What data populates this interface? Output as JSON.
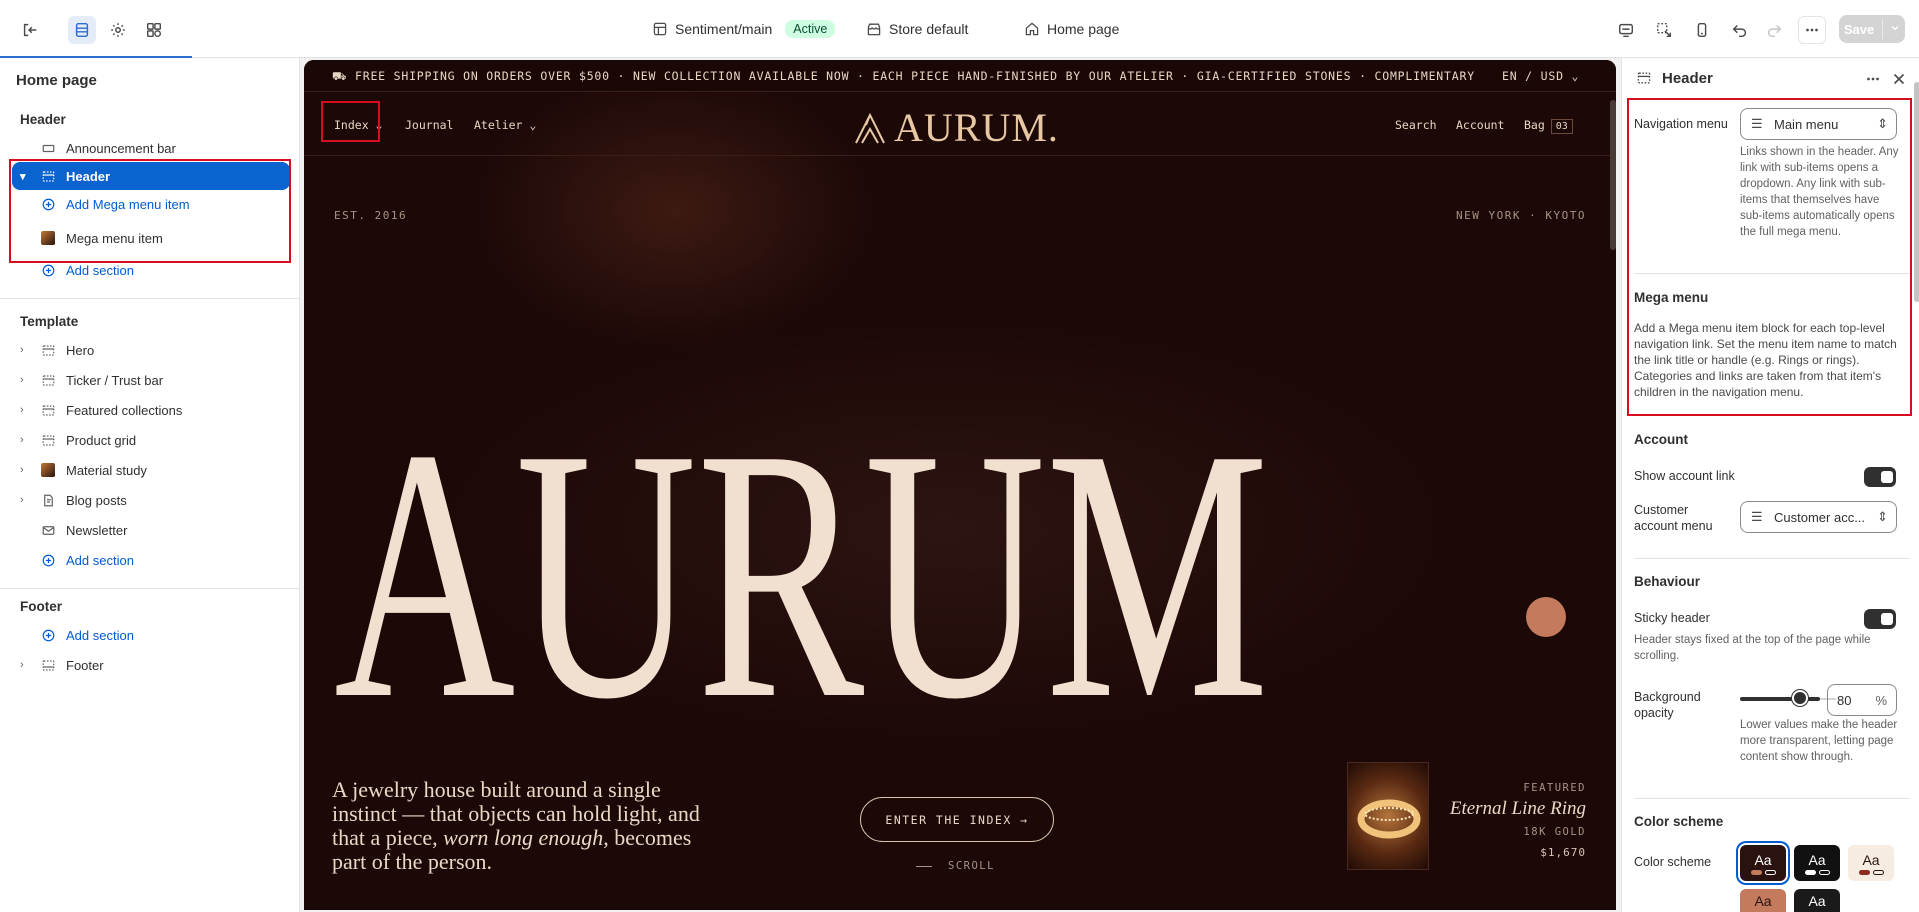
{
  "topbar": {
    "theme_name": "Sentiment/main",
    "theme_status": "Active",
    "store": "Store default",
    "page": "Home page",
    "save_label": "Save"
  },
  "left": {
    "title": "Home page",
    "header_group": "Header",
    "items_header": {
      "announcement": "Announcement bar",
      "header": "Header",
      "add_mega": "Add Mega menu item",
      "mega_item": "Mega menu item",
      "add_section": "Add section"
    },
    "template_group": "Template",
    "template_items": [
      "Hero",
      "Ticker / Trust bar",
      "Featured collections",
      "Product grid",
      "Material study",
      "Blog posts",
      "Newsletter"
    ],
    "template_add": "Add section",
    "footer_group": "Footer",
    "footer_add": "Add section",
    "footer_item": "Footer"
  },
  "preview": {
    "ticker": "FREE SHIPPING ON ORDERS OVER $500 · NEW COLLECTION AVAILABLE NOW · EACH PIECE HAND-FINISHED BY OUR ATELIER · GIA-CERTIFIED STONES · COMPLIMENTARY",
    "currency": "EN / USD",
    "nav_index": "Index",
    "nav_journal": "Journal",
    "nav_atelier": "Atelier",
    "logo": "AURUM.",
    "nav_search": "Search",
    "nav_account": "Account",
    "nav_bag": "Bag",
    "bag_count": "03",
    "est": "EST. 2016",
    "cities": "NEW YORK · KYOTO",
    "hero_word": "AURUM",
    "tagline_1": "A jewelry house built around a single instinct — that objects can hold light, and that a piece, ",
    "tagline_em": "worn long enough,",
    "tagline_2": " becomes part of the person.",
    "cta": "ENTER THE INDEX →",
    "scroll": "SCROLL",
    "featured_label": "FEATURED",
    "featured_name": "Eternal Line Ring",
    "featured_material": "18K GOLD",
    "featured_price": "$1,670"
  },
  "right": {
    "title": "Header",
    "nav_menu_label": "Navigation menu",
    "nav_menu_value": "Main menu",
    "nav_menu_help": "Links shown in the header. Any link with sub-items opens a dropdown. Any link with sub-items that themselves have sub-items automatically opens the full mega menu.",
    "mega_title": "Mega menu",
    "mega_help": "Add a Mega menu item block for each top-level navigation link. Set the menu item name to match the link title or handle (e.g. Rings or rings). Categories and links are taken from that item's children in the navigation menu.",
    "account_title": "Account",
    "show_account": "Show account link",
    "customer_menu_label": "Customer account menu",
    "customer_menu_value": "Customer acc...",
    "behaviour_title": "Behaviour",
    "sticky": "Sticky header",
    "sticky_help": "Header stays fixed at the top of the page while scrolling.",
    "bg_opacity_label": "Background opacity",
    "bg_opacity_value": "80",
    "bg_opacity_unit": "%",
    "bg_opacity_help": "Lower values make the header more transparent, letting page content show through.",
    "color_scheme_title": "Color scheme",
    "color_scheme_label": "Color scheme",
    "swatch_text": "Aa"
  },
  "colors": {
    "accent": "#005bd3",
    "selected": "#0b63d0",
    "highlight": "#d50f1f",
    "preview_bg": "#1b0807",
    "gold": "#e8c7a3"
  },
  "icons": [
    "exit-icon",
    "sections-icon",
    "gear-icon",
    "apps-icon",
    "theme-icon",
    "store-icon",
    "home-icon",
    "desktop-icon",
    "inspector-icon",
    "mobile-icon",
    "undo-icon",
    "redo-icon",
    "more-icon"
  ]
}
